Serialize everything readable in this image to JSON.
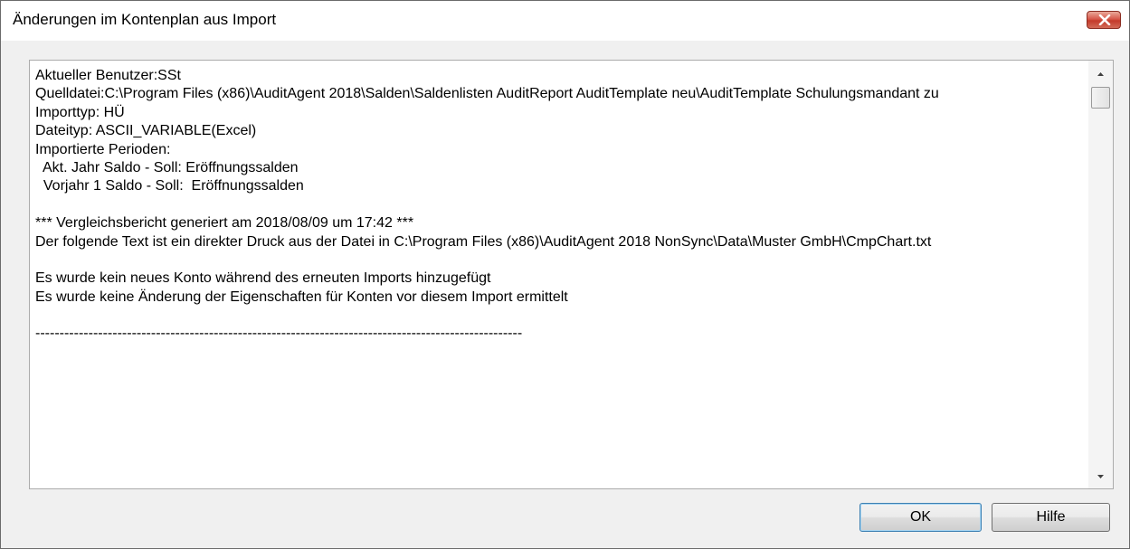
{
  "window": {
    "title": "Änderungen im Kontenplan aus Import"
  },
  "report": {
    "lines": [
      "Aktueller Benutzer:SSt",
      "Quelldatei:C:\\Program Files (x86)\\AuditAgent 2018\\Salden\\Saldenlisten AuditReport AuditTemplate neu\\AuditTemplate Schulungsmandant zu",
      "Importtyp: HÜ",
      "Dateityp: ASCII_VARIABLE(Excel)",
      "Importierte Perioden:",
      "  Akt. Jahr Saldo - Soll: Eröffnungssalden",
      "  Vorjahr 1 Saldo - Soll:  Eröffnungssalden",
      "",
      "*** Vergleichsbericht generiert am 2018/08/09 um 17:42 ***",
      "Der folgende Text ist ein direkter Druck aus der Datei in C:\\Program Files (x86)\\AuditAgent 2018 NonSync\\Data\\Muster GmbH\\CmpChart.txt",
      "",
      "Es wurde kein neues Konto während des erneuten Imports hinzugefügt",
      "Es wurde keine Änderung der Eigenschaften für Konten vor diesem Import ermittelt",
      "",
      "-----------------------------------------------------------------------------------------------------"
    ]
  },
  "buttons": {
    "ok_label": "OK",
    "help_label": "Hilfe"
  },
  "icons": {
    "close": "close-icon",
    "scroll_up": "arrow-up-icon",
    "scroll_down": "arrow-down-icon"
  }
}
